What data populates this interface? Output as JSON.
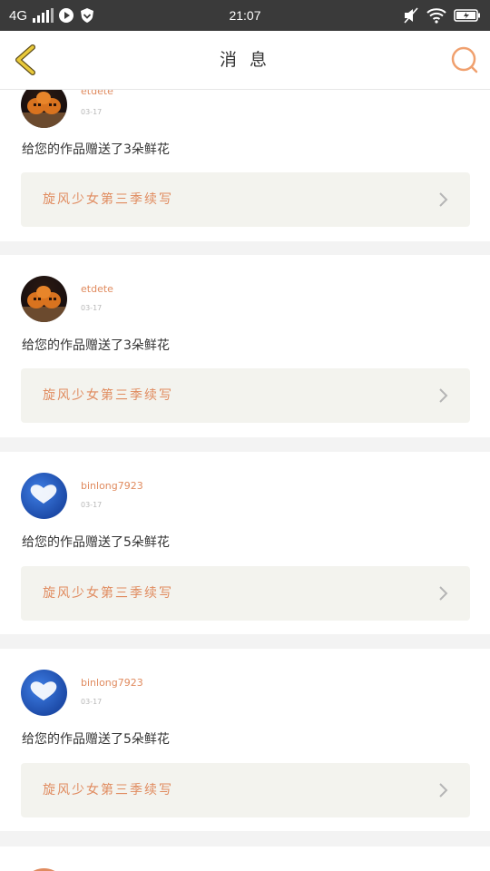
{
  "status_bar": {
    "network": "4G",
    "time": "21:07"
  },
  "nav": {
    "title": "消 息"
  },
  "colors": {
    "accent": "#e08b5f",
    "back_icon": "#e9c93a",
    "card_button_bg": "#f3f3ee"
  },
  "messages": [
    {
      "username": "etdete",
      "date": "03-17",
      "text": "给您的作品赠送了3朵鲜花",
      "work_title": "旋风少女第三季续写",
      "avatar": "pumpkin"
    },
    {
      "username": "etdete",
      "date": "03-17",
      "text": "给您的作品赠送了3朵鲜花",
      "work_title": "旋风少女第三季续写",
      "avatar": "pumpkin"
    },
    {
      "username": "binlong7923",
      "date": "03-17",
      "text": "给您的作品赠送了5朵鲜花",
      "work_title": "旋风少女第三季续写",
      "avatar": "heart-cloud"
    },
    {
      "username": "binlong7923",
      "date": "03-17",
      "text": "给您的作品赠送了5朵鲜花",
      "work_title": "旋风少女第三季续写",
      "avatar": "heart-cloud"
    }
  ]
}
